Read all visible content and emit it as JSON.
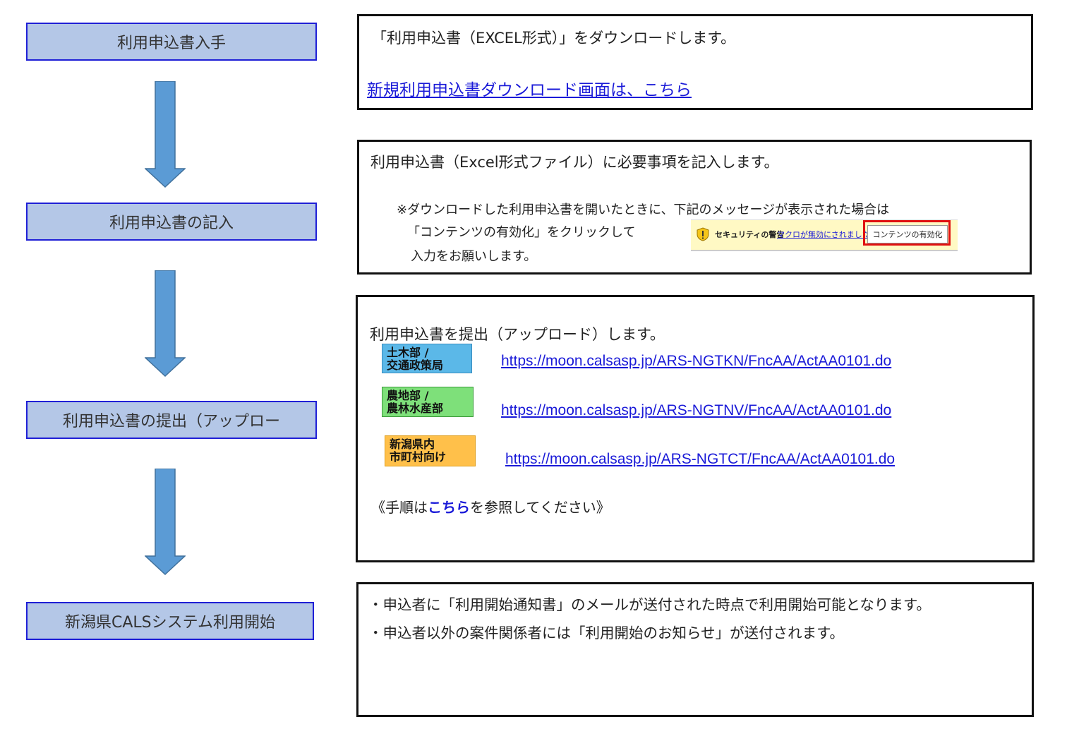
{
  "steps": [
    "利用申込書入手",
    "利用申込書の記入",
    "利用申込書の提出（アップロー",
    "新潟県CALSシステム利用開始"
  ],
  "box1": {
    "text": "「利用申込書（EXCEL形式）」をダウンロードします。",
    "link": "新規利用申込書ダウンロード画面は、こちら"
  },
  "box2": {
    "text": "利用申込書（Excel形式ファイル）に必要事項を記入します。",
    "note1": "※ダウンロードした利用申込書を開いたときに、下記のメッセージが表示された場合は",
    "note2": "「コンテンツの有効化」をクリックして",
    "note3": "入力をお願いします。",
    "macro_bar": {
      "security_label": "セキュリティの警告",
      "macro_label": "マクロが無効にされました。",
      "enable_button": "コンテンツの有効化"
    }
  },
  "box3": {
    "text": "利用申込書を提出（アップロード）します。",
    "entries": [
      {
        "badge1": "土木部 /",
        "badge2": "交通政策局",
        "url": "https://moon.calsasp.jp/ARS-NGTKN/FncAA/ActAA0101.do",
        "color": "#5bb8e8"
      },
      {
        "badge1": "農地部 /",
        "badge2": "農林水産部",
        "url": "https://moon.calsasp.jp/ARS-NGTNV/FncAA/ActAA0101.do",
        "color": "#7ee07a"
      },
      {
        "badge1": "新潟県内",
        "badge2": "市町村向け",
        "url": "https://moon.calsasp.jp/ARS-NGTCT/FncAA/ActAA0101.do",
        "color": "#ffc04a"
      }
    ],
    "procedure_prefix": "《手順は",
    "procedure_link": "こちら",
    "procedure_suffix": "を参照してください》"
  },
  "box4": {
    "line1": "・申込者に「利用開始通知書」のメールが送付された時点で利用開始可能となります。",
    "line2": "・申込者以外の案件関係者には「利用開始のお知らせ」が送付されます。"
  },
  "colors": {
    "step_fill": "#b4c7e7",
    "step_border": "#1f1fd6",
    "arrow": "#5b9bd5",
    "link": "#1a1ad8"
  }
}
